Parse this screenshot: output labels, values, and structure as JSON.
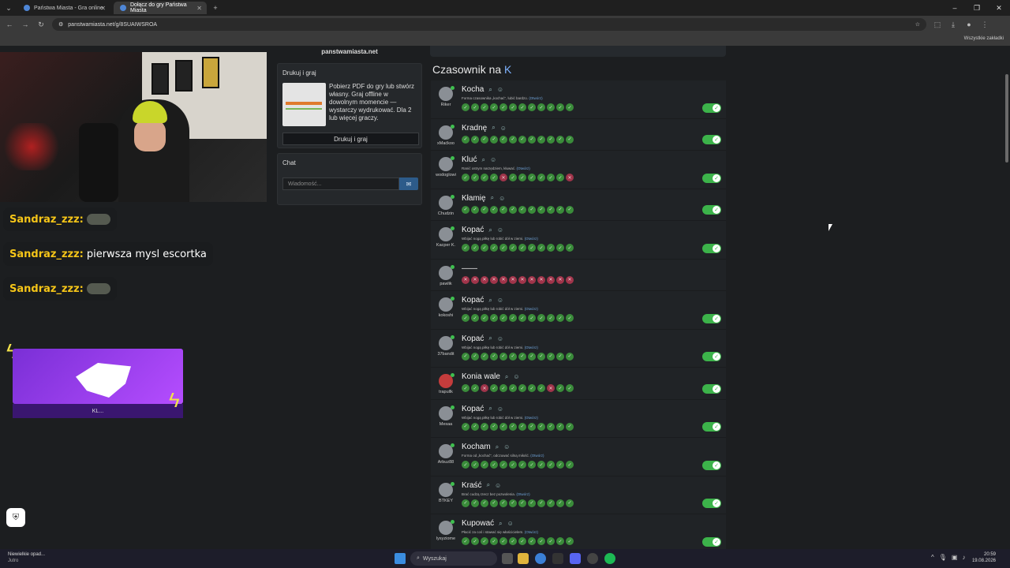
{
  "browser": {
    "tabs": [
      {
        "title": "Państwa Miasta - Gra online",
        "active": false
      },
      {
        "title": "Dołącz do gry Państwa Miasta",
        "active": true
      }
    ],
    "url": "panstwamiasta.net/g/8SUAIWSROA",
    "bookmarks_label": "Wszystkie zakładki"
  },
  "stream_chat": [
    {
      "user": "Sandraz_zzz:",
      "text": "",
      "emote": true
    },
    {
      "user": "Sandraz_zzz:",
      "text": "pierwsza mysl escortka",
      "emote": false
    },
    {
      "user": "Sandraz_zzz:",
      "text": "",
      "emote": true
    }
  ],
  "alert": {
    "bottom_text": "KL..."
  },
  "sidebar": {
    "site_name": "panstwamiasta.net",
    "print": {
      "title": "Drukuj i graj",
      "description": "Pobierz PDF do gry lub stwórz własny. Graj offline w dowolnym momencie — wystarczy wydrukować. Dla 2 lub więcej graczy.",
      "button": "Drukuj i graj"
    },
    "chat": {
      "title": "Chat",
      "placeholder": "Wiadomość..."
    }
  },
  "category": {
    "label": "Czasownik na",
    "letter": "K"
  },
  "results": [
    {
      "user": "Riker",
      "word": "Kocha",
      "def": "Forma czasownika „kochać”, lubić bardzo.",
      "open": "(Otwórz)",
      "marks": "gggggggggggg",
      "accepted": true
    },
    {
      "user": "xMaćkoo",
      "word": "Kradnę",
      "def": "",
      "open": "",
      "marks": "gggggggggggg",
      "accepted": true
    },
    {
      "user": "wodoglowi",
      "word": "Kluć",
      "def": "Ranić ostrym narzędziem, kłuwać.",
      "open": "(Otwórz)",
      "marks": "ggggrggggggr",
      "accepted": true
    },
    {
      "user": "Chudzin",
      "word": "Kłamię",
      "def": "",
      "open": "",
      "marks": "gggggggggggg",
      "accepted": true
    },
    {
      "user": "Kacper K.",
      "word": "Kopać",
      "def": "Wbijać nogą piłkę lub robić dół w ziemi.",
      "open": "(Otwórz)",
      "marks": "gggggggggggg",
      "accepted": true
    },
    {
      "user": "pawlik",
      "word": "——",
      "def": "",
      "open": "",
      "marks": "rrrrrrrrrrrr",
      "accepted": false
    },
    {
      "user": "kokoshi",
      "word": "Kopać",
      "def": "Wbijać nogą piłkę lub robić dół w ziemi.",
      "open": "(Otwórz)",
      "marks": "gggggggggggg",
      "accepted": true
    },
    {
      "user": "37bandit",
      "word": "Kopać",
      "def": "Wbijać nogą piłkę lub robić dół w ziemi.",
      "open": "(Otwórz)",
      "marks": "gggggggggggg",
      "accepted": true
    },
    {
      "user": "trapullk",
      "word": "Konia wale",
      "def": "",
      "open": "",
      "marks": "ggrggggggrgg",
      "accepted": true
    },
    {
      "user": "Mesaa",
      "word": "Kopać",
      "def": "Wbijać nogą piłkę lub robić dół w ziemi.",
      "open": "(Otwórz)",
      "marks": "gggggggggggg",
      "accepted": true
    },
    {
      "user": "Arbuz88",
      "word": "Kocham",
      "def": "Forma od „kochać”, odczuwać silną miłość.",
      "open": "(Otwórz)",
      "marks": "gggggggggggg",
      "accepted": true
    },
    {
      "user": "BTKEY",
      "word": "Kraść",
      "def": "Brać cudzą rzecz bez pozwolenia.",
      "open": "(Otwórz)",
      "marks": "gggggggggggg",
      "accepted": true
    },
    {
      "user": "lysyziome",
      "word": "Kupować",
      "def": "Płacić za coś i stawać się właścicielem.",
      "open": "(Otwórz)",
      "marks": "gggggggggggg",
      "accepted": true
    }
  ],
  "taskbar": {
    "weather_title": "Niewielkie opad...",
    "weather_sub": "Jutro",
    "search": "Wyszukaj",
    "time": "20:59",
    "date": "19.08.2026"
  }
}
